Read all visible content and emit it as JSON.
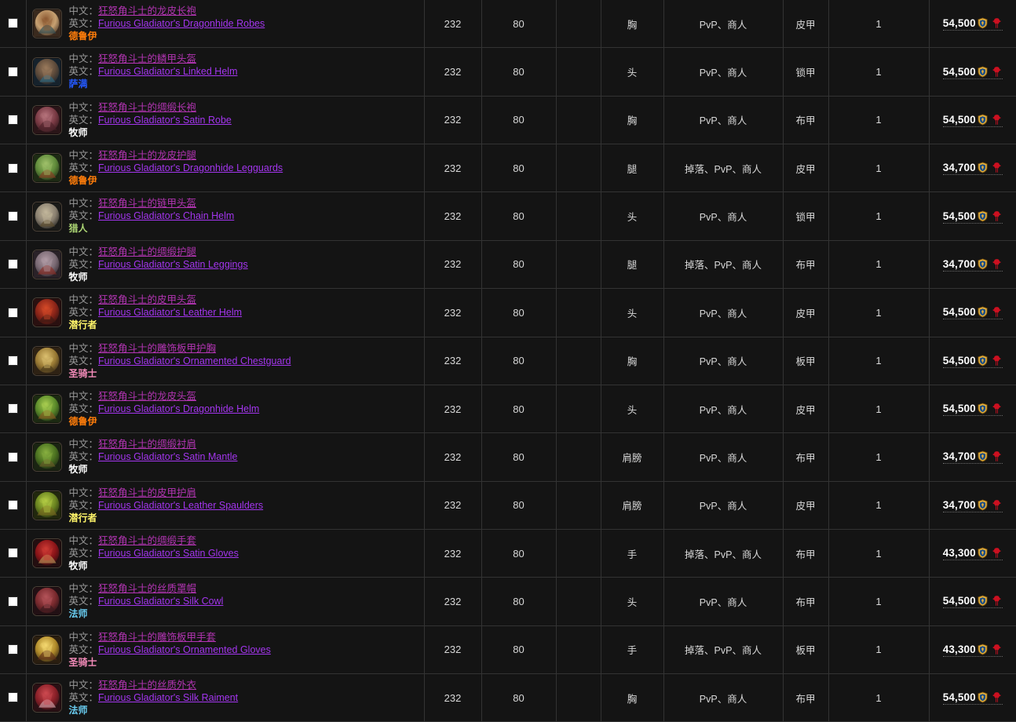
{
  "table": {
    "labels": {
      "zh": "中文：",
      "en": "英文："
    },
    "currency": {
      "alliance_icon": "alliance-honor-icon",
      "horde_icon": "horde-honor-icon",
      "alliance_color": "#e8b13a",
      "horde_color": "#cc1020"
    },
    "columns": [
      {
        "key": "check",
        "label": ""
      },
      {
        "key": "item",
        "label": ""
      },
      {
        "key": "ilvl",
        "label": ""
      },
      {
        "key": "req",
        "label": ""
      },
      {
        "key": "blank",
        "label": ""
      },
      {
        "key": "slot",
        "label": ""
      },
      {
        "key": "source",
        "label": ""
      },
      {
        "key": "armor",
        "label": ""
      },
      {
        "key": "qty",
        "label": ""
      },
      {
        "key": "cost",
        "label": ""
      }
    ],
    "rows": [
      {
        "zh": "狂怒角斗士的龙皮长袍",
        "en": "Furious Gladiator's Dragonhide Robes",
        "cls": "德鲁伊",
        "cls_key": "druid",
        "ilvl": "232",
        "req": "80",
        "blank": "",
        "slot": "胸",
        "source": "PvP、商人",
        "armor": "皮甲",
        "qty": "1",
        "cost": "54,500",
        "icon": "chest-dragonhide-robes-icon",
        "icon_colors": [
          "#3a2a1e",
          "#c7a172",
          "#8d5a33",
          "#2b4a52"
        ]
      },
      {
        "zh": "狂怒角斗士的鳞甲头盔",
        "en": "Furious Gladiator's Linked Helm",
        "cls": "萨满",
        "cls_key": "shaman",
        "ilvl": "232",
        "req": "80",
        "blank": "",
        "slot": "头",
        "source": "PvP、商人",
        "armor": "锁甲",
        "qty": "1",
        "cost": "54,500",
        "icon": "helm-linked-icon",
        "icon_colors": [
          "#16222c",
          "#5d4a3a",
          "#9a7a5c",
          "#2c6a86"
        ]
      },
      {
        "zh": "狂怒角斗士的绸缎长袍",
        "en": "Furious Gladiator's Satin Robe",
        "cls": "牧师",
        "cls_key": "priest",
        "ilvl": "232",
        "req": "80",
        "blank": "",
        "slot": "胸",
        "source": "PvP、商人",
        "armor": "布甲",
        "qty": "1",
        "cost": "54,500",
        "icon": "chest-satin-robe-icon",
        "icon_colors": [
          "#2a1518",
          "#7a3a44",
          "#b5737c",
          "#4a2028"
        ]
      },
      {
        "zh": "狂怒角斗士的龙皮护腿",
        "en": "Furious Gladiator's Dragonhide Legguards",
        "cls": "德鲁伊",
        "cls_key": "druid",
        "ilvl": "232",
        "req": "80",
        "blank": "",
        "slot": "腿",
        "source": "掉落、PvP、商人",
        "armor": "皮甲",
        "qty": "1",
        "cost": "34,700",
        "icon": "legs-dragonhide-icon",
        "icon_colors": [
          "#1d2a14",
          "#5f8a3a",
          "#9fc06a",
          "#8a3a22"
        ]
      },
      {
        "zh": "狂怒角斗士的链甲头盔",
        "en": "Furious Gladiator's Chain Helm",
        "cls": "猎人",
        "cls_key": "hunter",
        "ilvl": "232",
        "req": "80",
        "blank": "",
        "slot": "头",
        "source": "PvP、商人",
        "armor": "锁甲",
        "qty": "1",
        "cost": "54,500",
        "icon": "helm-chain-icon",
        "icon_colors": [
          "#1a1a18",
          "#8a8070",
          "#c4b89c",
          "#5a4a2a"
        ]
      },
      {
        "zh": "狂怒角斗士的绸缎护腿",
        "en": "Furious Gladiator's Satin Leggings",
        "cls": "牧师",
        "cls_key": "priest",
        "ilvl": "232",
        "req": "80",
        "blank": "",
        "slot": "腿",
        "source": "掉落、PvP、商人",
        "armor": "布甲",
        "qty": "1",
        "cost": "34,700",
        "icon": "legs-satin-icon",
        "icon_colors": [
          "#2a2228",
          "#7a6a74",
          "#b09aa4",
          "#8a2a20"
        ]
      },
      {
        "zh": "狂怒角斗士的皮甲头盔",
        "en": "Furious Gladiator's Leather Helm",
        "cls": "潜行者",
        "cls_key": "rogue",
        "ilvl": "232",
        "req": "80",
        "blank": "",
        "slot": "头",
        "source": "PvP、商人",
        "armor": "皮甲",
        "qty": "1",
        "cost": "54,500",
        "icon": "helm-leather-icon",
        "icon_colors": [
          "#2a1010",
          "#8a2418",
          "#d44a28",
          "#3a1a14"
        ]
      },
      {
        "zh": "狂怒角斗士的雕饰板甲护胸",
        "en": "Furious Gladiator's Ornamented Chestguard",
        "cls": "圣骑士",
        "cls_key": "paladin",
        "ilvl": "232",
        "req": "80",
        "blank": "",
        "slot": "胸",
        "source": "PvP、商人",
        "armor": "板甲",
        "qty": "1",
        "cost": "54,500",
        "icon": "chest-ornamented-icon",
        "icon_colors": [
          "#2e2214",
          "#9a7a34",
          "#dcc070",
          "#4a3a1a"
        ]
      },
      {
        "zh": "狂怒角斗士的龙皮头盔",
        "en": "Furious Gladiator's Dragonhide Helm",
        "cls": "德鲁伊",
        "cls_key": "druid",
        "ilvl": "232",
        "req": "80",
        "blank": "",
        "slot": "头",
        "source": "PvP、商人",
        "armor": "皮甲",
        "qty": "1",
        "cost": "54,500",
        "icon": "helm-dragonhide-icon",
        "icon_colors": [
          "#1c2a12",
          "#5a8a2a",
          "#a8cc50",
          "#8a5a20"
        ]
      },
      {
        "zh": "狂怒角斗士的绸缎衬肩",
        "en": "Furious Gladiator's Satin Mantle",
        "cls": "牧师",
        "cls_key": "priest",
        "ilvl": "232",
        "req": "80",
        "blank": "",
        "slot": "肩膀",
        "source": "PvP、商人",
        "armor": "布甲",
        "qty": "1",
        "cost": "34,700",
        "icon": "shoulder-satin-icon",
        "icon_colors": [
          "#1a2412",
          "#4a7020",
          "#88b040",
          "#6a5a28"
        ]
      },
      {
        "zh": "狂怒角斗士的皮甲护肩",
        "en": "Furious Gladiator's Leather Spaulders",
        "cls": "潜行者",
        "cls_key": "rogue",
        "ilvl": "232",
        "req": "80",
        "blank": "",
        "slot": "肩膀",
        "source": "PvP、商人",
        "armor": "皮甲",
        "qty": "1",
        "cost": "34,700",
        "icon": "shoulder-leather-icon",
        "icon_colors": [
          "#22280e",
          "#6a8420",
          "#b4cc44",
          "#7a6a20"
        ]
      },
      {
        "zh": "狂怒角斗士的绸缎手套",
        "en": "Furious Gladiator's Satin Gloves",
        "cls": "牧师",
        "cls_key": "priest",
        "ilvl": "232",
        "req": "80",
        "blank": "",
        "slot": "手",
        "source": "掉落、PvP、商人",
        "armor": "布甲",
        "qty": "1",
        "cost": "43,300",
        "icon": "gloves-satin-icon",
        "icon_colors": [
          "#240e10",
          "#8a1418",
          "#cc3a34",
          "#c09a5a"
        ]
      },
      {
        "zh": "狂怒角斗士的丝质罩帽",
        "en": "Furious Gladiator's Silk Cowl",
        "cls": "法师",
        "cls_key": "mage",
        "ilvl": "232",
        "req": "80",
        "blank": "",
        "slot": "头",
        "source": "PvP、商人",
        "armor": "布甲",
        "qty": "1",
        "cost": "54,500",
        "icon": "helm-silk-cowl-icon",
        "icon_colors": [
          "#221014",
          "#7a2a2e",
          "#b4545a",
          "#3a1a1e"
        ]
      },
      {
        "zh": "狂怒角斗士的雕饰板甲手套",
        "en": "Furious Gladiator's Ornamented Gloves",
        "cls": "圣骑士",
        "cls_key": "paladin",
        "ilvl": "232",
        "req": "80",
        "blank": "",
        "slot": "手",
        "source": "掉落、PvP、商人",
        "armor": "板甲",
        "qty": "1",
        "cost": "43,300",
        "icon": "gloves-ornamented-icon",
        "icon_colors": [
          "#2a1e10",
          "#b08a2a",
          "#f4d870",
          "#5a2a18"
        ]
      },
      {
        "zh": "狂怒角斗士的丝质外衣",
        "en": "Furious Gladiator's Silk Raiment",
        "cls": "法师",
        "cls_key": "mage",
        "ilvl": "232",
        "req": "80",
        "blank": "",
        "slot": "胸",
        "source": "PvP、商人",
        "armor": "布甲",
        "qty": "1",
        "cost": "54,500",
        "icon": "chest-silk-raiment-icon",
        "icon_colors": [
          "#2a1014",
          "#8a2028",
          "#cc4a50",
          "#d8a8b0"
        ]
      }
    ]
  }
}
